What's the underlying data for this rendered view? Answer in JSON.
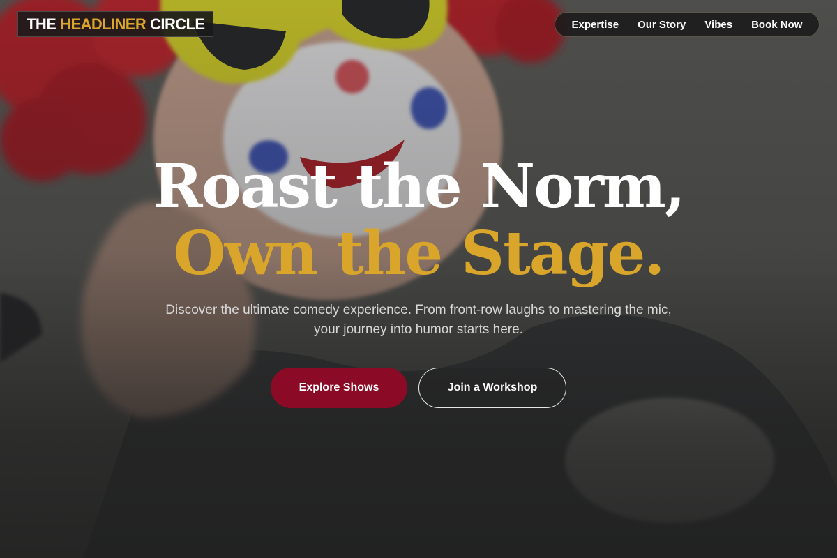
{
  "brand": {
    "logo_part1": "THE",
    "logo_part2": "HEADLINER",
    "logo_part3": "CIRCLE",
    "accent_color": "#d9a62b"
  },
  "nav": {
    "items": [
      {
        "label": "Expertise"
      },
      {
        "label": "Our Story"
      },
      {
        "label": "Vibes"
      },
      {
        "label": "Book Now"
      }
    ]
  },
  "hero": {
    "headline_line1": "Roast the Norm,",
    "headline_line2": "Own the Stage.",
    "subtitle_line1": "Discover the ultimate comedy experience. From front-row laughs to mastering the mic,",
    "subtitle_line2": "your journey into humor starts here.",
    "primary_button": "Explore Shows",
    "secondary_button": "Join a Workshop",
    "primary_color": "#8b0a26"
  }
}
